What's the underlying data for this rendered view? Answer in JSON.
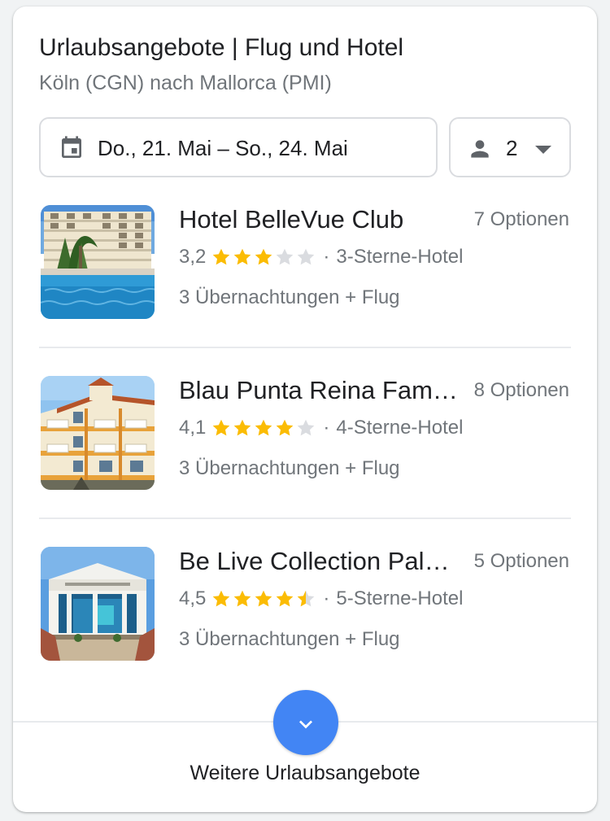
{
  "header": {
    "title": "Urlaubsangebote | Flug und Hotel",
    "subtitle": "Köln (CGN) nach Mallorca (PMI)"
  },
  "filters": {
    "dates": "Do., 21. Mai – So., 24. Mai",
    "guests": "2"
  },
  "icons": {
    "calendar": "calendar-icon",
    "person": "person-icon",
    "dropdown": "arrow-drop-down-icon",
    "expand": "chevron-down-icon",
    "star": "star-icon"
  },
  "colors": {
    "star_filled": "#fbbc04",
    "star_empty": "#dadce0",
    "accent": "#4285f4"
  },
  "hotels": [
    {
      "name": "Hotel BelleVue Club",
      "options": "7 Optionen",
      "rating_text": "3,2",
      "rating_value": 3.0,
      "class": "3-Sterne-Hotel",
      "sub": "3 Übernachtungen + Flug"
    },
    {
      "name": "Blau Punta Reina Family Resort",
      "options": "8 Optionen",
      "rating_text": "4,1",
      "rating_value": 4.0,
      "class": "4-Sterne-Hotel",
      "sub": "3 Übernachtungen + Flug"
    },
    {
      "name": "Be Live Collection Palace de Muro",
      "options": "5 Optionen",
      "rating_text": "4,5",
      "rating_value": 4.5,
      "class": "5-Sterne-Hotel",
      "sub": "3 Übernachtungen + Flug"
    }
  ],
  "separator": "·",
  "footer": {
    "more_label": "Weitere Urlaubsangebote"
  }
}
